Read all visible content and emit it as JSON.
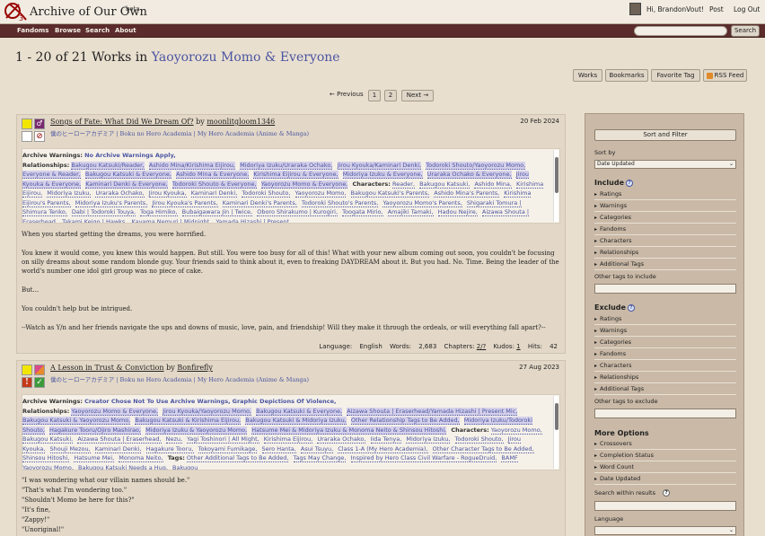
{
  "header": {
    "site_title": "Archive of Our Own",
    "beta": "beta",
    "greeting": "Hi, BrandonVout!",
    "post": "Post",
    "logout": "Log Out"
  },
  "nav": {
    "items": [
      "Fandoms",
      "Browse",
      "Search",
      "About"
    ],
    "search_button": "Search"
  },
  "heading": {
    "prefix": "1 - 20 of 21 Works in ",
    "tag": "Yaoyorozu Momo & Everyone"
  },
  "actions": [
    "Works",
    "Bookmarks",
    "Favorite Tag",
    "RSS Feed"
  ],
  "pagination": {
    "previous": "← Previous",
    "pages": [
      "1",
      "2"
    ],
    "next": "Next →"
  },
  "works": [
    {
      "title": "Songs of Fate: What Did We Dream Of?",
      "by": "by",
      "author": "moonlitgloom1346",
      "fandoms": "僕のヒーローアカデミア | Boku no Hero Academia | My Hero Academia (Anime & Manga)",
      "date": "20 Feb 2024",
      "warnings_label": "Archive Warnings:",
      "warnings": "No Archive Warnings Apply,",
      "relationships_label": "Relationships:",
      "relationships": [
        "Bakugou Katsuki/Reader,",
        "Ashido Mina/Kirishima Eijirou,",
        "Midoriya Izuku/Uraraka Ochako,",
        "Jirou Kyouka/Kaminari Denki,",
        "Todoroki Shouto/Yaoyorozu Momo,",
        "Everyone & Reader,",
        "Bakugou Katsuki & Everyone,",
        "Ashido Mina & Everyone,",
        "Kirishima Eijirou & Everyone,",
        "Midoriya Izuku & Everyone,",
        "Uraraka Ochako & Everyone,",
        "Jirou Kyouka & Everyone,",
        "Kaminari Denki & Everyone,",
        "Todoroki Shouto & Everyone,",
        "Yaoyorozu Momo & Everyone,"
      ],
      "characters_label": "Characters:",
      "characters": [
        "Reader,",
        "Bakugou Katsuki,",
        "Ashido Mina,",
        "Kirishima Eijirou,",
        "Midoriya Izuku,",
        "Uraraka Ochako,",
        "Jirou Kyouka,",
        "Kaminari Denki,",
        "Todoroki Shouto,",
        "Yaoyorozu Momo,",
        "Bakugou Katsuki's Parents,",
        "Ashido Mina's Parents,",
        "Kirishima Eijirou's Parents,",
        "Midoriya Izuku's Parents,",
        "Jirou Kyouka's Parents,",
        "Kaminari Denki's Parents,",
        "Todoroki Shouto's Parents,",
        "Yaoyorozu Momo's Parents,",
        "Shigaraki Tomura | Shimura Tenko,",
        "Dabi | Todoroki Touya,",
        "Toga Himiko,",
        "Bubaigawara Jin | Twice,",
        "Oboro Shirakumo | Kurogiri,",
        "Toogata Mirio,",
        "Amajiki Tamaki,",
        "Hadou Nejire,",
        "Aizawa Shouta | Eraserhead,",
        "Takami Keigo | Hawks,",
        "Kayama Nemuri | Midnight,",
        "Yamada Hizashi | Present"
      ],
      "summary": [
        "When you started getting the dreams, you were horrified.",
        "You knew it would come, you knew this would happen. But still. You were too busy for all of this! What with your new album coming out soon, you couldn't be focusing on silly dreams about some random blonde guy. Your friends said to think about it, even to freaking DAYDREAM about it. But you had. No. Time. Being the leader of the world's number one idol girl group was no piece of cake.",
        "But...",
        "You couldn't help but be intrigued.",
        "--Watch as Y/n and her friends navigate the ups and downs of music, love, pain, and friendship! Will they make it through the ordeals, or will everything fall apart?--"
      ],
      "stats": {
        "language_label": "Language:",
        "language": "English",
        "words_label": "Words:",
        "words": "2,683",
        "chapters_label": "Chapters:",
        "chapters": "2/?",
        "kudos_label": "Kudos:",
        "kudos": "1",
        "hits_label": "Hits:",
        "hits": "42"
      }
    },
    {
      "title": "A Lesson in Trust & Conviction",
      "by": "by",
      "author": "Bonfirefly",
      "fandoms": "僕のヒーローアカデミア | Boku no Hero Academia | My Hero Academia (Anime & Manga)",
      "date": "27 Aug 2023",
      "warnings_label": "Archive Warnings:",
      "warnings": "Creator Chose Not To Use Archive Warnings,",
      "warnings2": "Graphic Depictions Of Violence,",
      "relationships_label": "Relationships:",
      "relationships": [
        "Yaoyorozu Momo & Everyone,",
        "Jirou Kyouka/Yaoyorozu Momo,",
        "Bakugou Katsuki & Everyone,",
        "Aizawa Shouta | Eraserhead/Yamada Hizashi | Present Mic,",
        "Bakugou Katsuki & Yaoyorozu Momo,",
        "Bakugou Katsuki & Kirishima Eijirou,",
        "Bakugou Katsuki & Midoriya Izuku,",
        "Other Relationship Tags to Be Added,",
        "Midoriya Izuku/Todoroki Shouto,",
        "Hagakure Tooru/Ojiro Mashirao,",
        "Midoriya Izuku & Yaoyorozu Momo,",
        "Hatsume Mei & Midoriya Izuku & Monoma Neito & Shinsou Hitoshi,"
      ],
      "characters_label": "Characters:",
      "characters": [
        "Yaoyorozu Momo,",
        "Bakugou Katsuki,",
        "Aizawa Shouta | Eraserhead,",
        "Nezu,",
        "Yagi Toshinori | All Might,",
        "Kirishima Eijirou,",
        "Uraraka Ochako,",
        "Iida Tenya,",
        "Midoriya Izuku,",
        "Todoroki Shouto,",
        "Jirou Kyouka,",
        "Shouji Mezou,",
        "Kaminari Denki,",
        "Hagakure Tooru,",
        "Tokoyami Fumikage,",
        "Sero Hanta,",
        "Asui Tsuyu,",
        "Class 1-A (My Hero Academia),",
        "Other Character Tags to Be Added,",
        "Shinsou Hitoshi,",
        "Hatsume Mei,",
        "Monoma Neito,"
      ],
      "tags_label": "Tags:",
      "tags": [
        "Other Additional Tags to Be Added,",
        "Tags May Change,",
        "Inspired by Hero Class Civil Warfare - RogueDruid,",
        "BAMF Yaoyorozu Momo,",
        "Bakugou Katsuki Needs a Hug,",
        "Bakugou"
      ],
      "summary": [
        "\"I was wondering what our villain names should be.\"",
        "\"That's what I'm wondering too.\"",
        "\"Shouldn't Momo be here for this?\"",
        "\"It's fine,",
        "\"Zappy!\"",
        "\"Unoriginal!\""
      ]
    }
  ],
  "sidebar": {
    "sort_filter": "Sort and Filter",
    "sort_by_label": "Sort by",
    "sort_by_value": "Date Updated",
    "include_heading": "Include",
    "include_items": [
      "Ratings",
      "Warnings",
      "Categories",
      "Fandoms",
      "Characters",
      "Relationships",
      "Additional Tags"
    ],
    "other_include_label": "Other tags to include",
    "exclude_heading": "Exclude",
    "exclude_items": [
      "Ratings",
      "Warnings",
      "Categories",
      "Fandoms",
      "Characters",
      "Relationships",
      "Additional Tags"
    ],
    "other_exclude_label": "Other tags to exclude",
    "more_heading": "More Options",
    "more_items": [
      "Crossovers",
      "Completion Status",
      "Word Count",
      "Date Updated"
    ],
    "search_within_label": "Search within results",
    "language_label": "Language"
  }
}
